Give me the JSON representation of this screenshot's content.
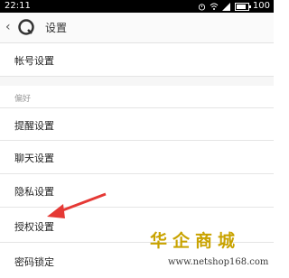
{
  "status_bar": {
    "time": "22:11",
    "battery": "100",
    "battery_level": 1.0
  },
  "header": {
    "title": "设置",
    "back_icon": "chevron-left-icon",
    "logo_icon": "app-logo-icon"
  },
  "rows": {
    "account": "帐号设置",
    "section_label": "偏好",
    "reminder": "提醒设置",
    "chat": "聊天设置",
    "privacy": "隐私设置",
    "authorization": "授权设置",
    "password_lock": "密码锁定"
  },
  "watermark": {
    "title": "华企商城",
    "url": "www.netshop168.com"
  },
  "colors": {
    "accent": "#e53935",
    "watermark": "#c9a300"
  }
}
